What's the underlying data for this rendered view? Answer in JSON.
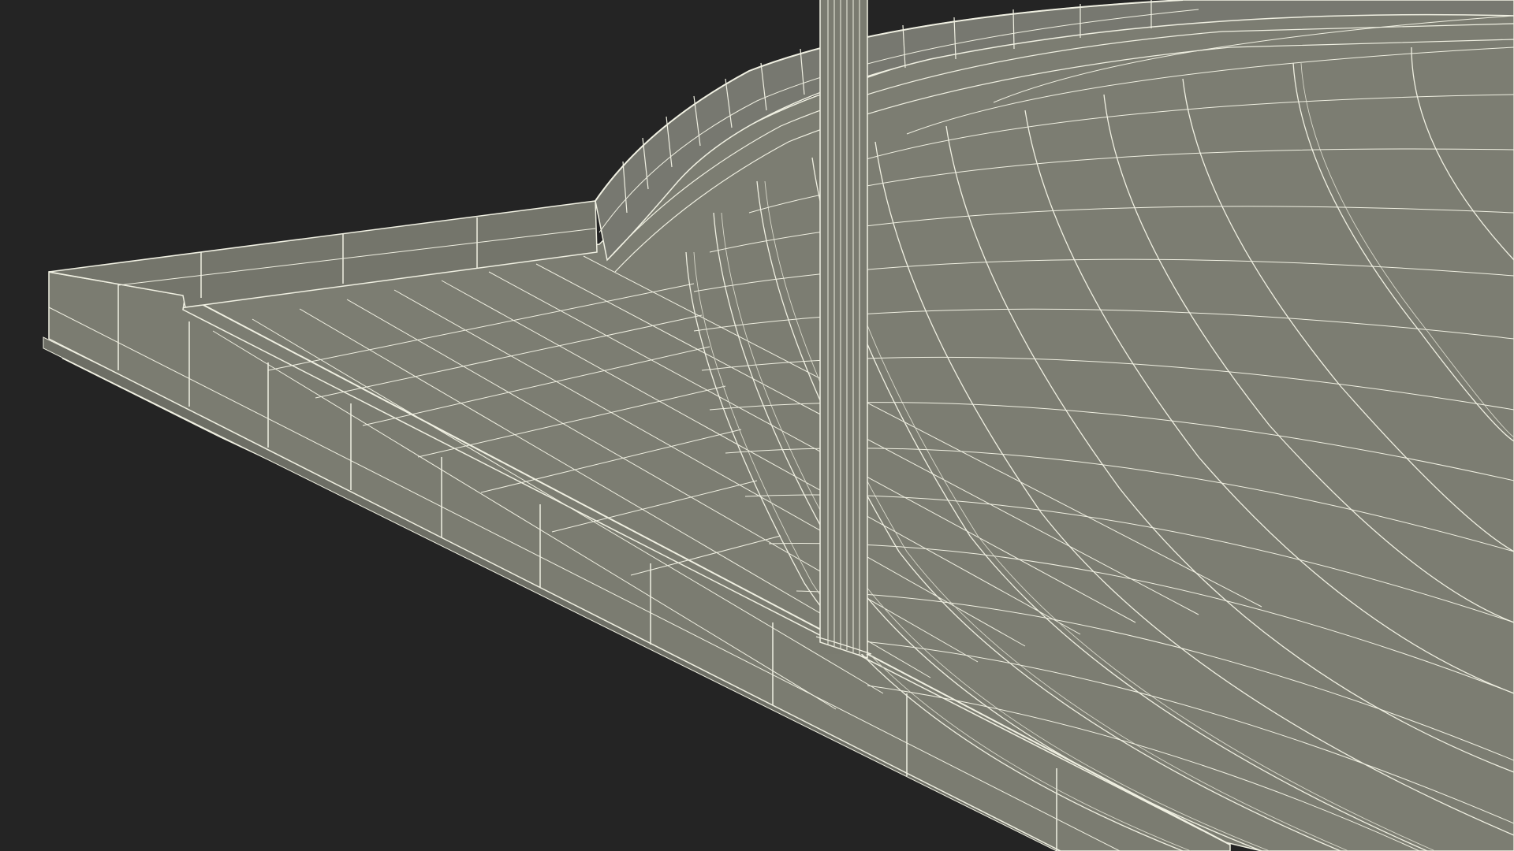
{
  "scene": {
    "colors": {
      "background": "#242424",
      "surface": "#7c7d72",
      "surface_dark": "#6e6f65",
      "wire": "#f0f0e2",
      "wire_dim": "#d8d8ca",
      "shadow": "#5f605a"
    },
    "objects": [
      "floor-slab",
      "front-curb",
      "left-curb",
      "curved-back-curb",
      "vertical-pole",
      "curved-ramp-bowl"
    ]
  }
}
